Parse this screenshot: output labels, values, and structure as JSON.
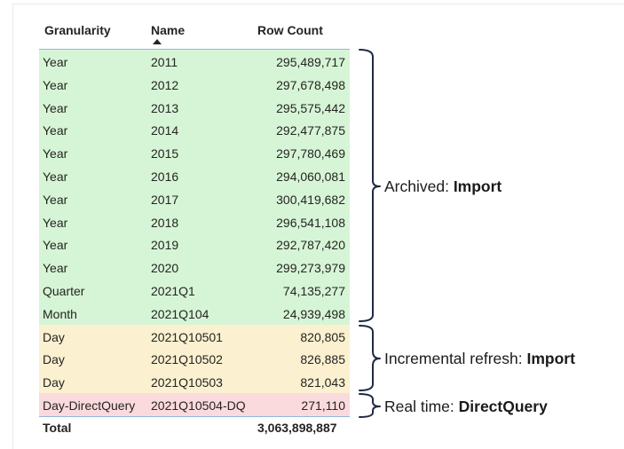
{
  "table": {
    "headers": {
      "granularity": "Granularity",
      "name": "Name",
      "row_count": "Row Count"
    },
    "sort": {
      "column": "Name",
      "direction": "ascending"
    },
    "rows": [
      {
        "granularity": "Year",
        "name": "2011",
        "row_count": "295,489,717",
        "group": "archived"
      },
      {
        "granularity": "Year",
        "name": "2012",
        "row_count": "297,678,498",
        "group": "archived"
      },
      {
        "granularity": "Year",
        "name": "2013",
        "row_count": "295,575,442",
        "group": "archived"
      },
      {
        "granularity": "Year",
        "name": "2014",
        "row_count": "292,477,875",
        "group": "archived"
      },
      {
        "granularity": "Year",
        "name": "2015",
        "row_count": "297,780,469",
        "group": "archived"
      },
      {
        "granularity": "Year",
        "name": "2016",
        "row_count": "294,060,081",
        "group": "archived"
      },
      {
        "granularity": "Year",
        "name": "2017",
        "row_count": "300,419,682",
        "group": "archived"
      },
      {
        "granularity": "Year",
        "name": "2018",
        "row_count": "296,541,108",
        "group": "archived"
      },
      {
        "granularity": "Year",
        "name": "2019",
        "row_count": "292,787,420",
        "group": "archived"
      },
      {
        "granularity": "Year",
        "name": "2020",
        "row_count": "299,273,979",
        "group": "archived"
      },
      {
        "granularity": "Quarter",
        "name": "2021Q1",
        "row_count": "74,135,277",
        "group": "archived"
      },
      {
        "granularity": "Month",
        "name": "2021Q104",
        "row_count": "24,939,498",
        "group": "archived"
      },
      {
        "granularity": "Day",
        "name": "2021Q10501",
        "row_count": "820,805",
        "group": "incremental"
      },
      {
        "granularity": "Day",
        "name": "2021Q10502",
        "row_count": "826,885",
        "group": "incremental"
      },
      {
        "granularity": "Day",
        "name": "2021Q10503",
        "row_count": "821,043",
        "group": "incremental"
      },
      {
        "granularity": "Day-DirectQuery",
        "name": "2021Q10504-DQ",
        "row_count": "271,110",
        "group": "realtime"
      }
    ],
    "total": {
      "label": "Total",
      "row_count": "3,063,898,887"
    }
  },
  "annotations": {
    "archived": {
      "prefix": "Archived: ",
      "mode": "Import"
    },
    "incremental": {
      "prefix": "Incremental refresh: ",
      "mode": "Import"
    },
    "realtime": {
      "prefix": "Real time: ",
      "mode": "DirectQuery"
    }
  },
  "colors": {
    "archived": "#d6f5d6",
    "incremental": "#fbf0cf",
    "realtime": "#fadadd",
    "border": "#8fb7e0",
    "bracket": "#1f2a44"
  }
}
